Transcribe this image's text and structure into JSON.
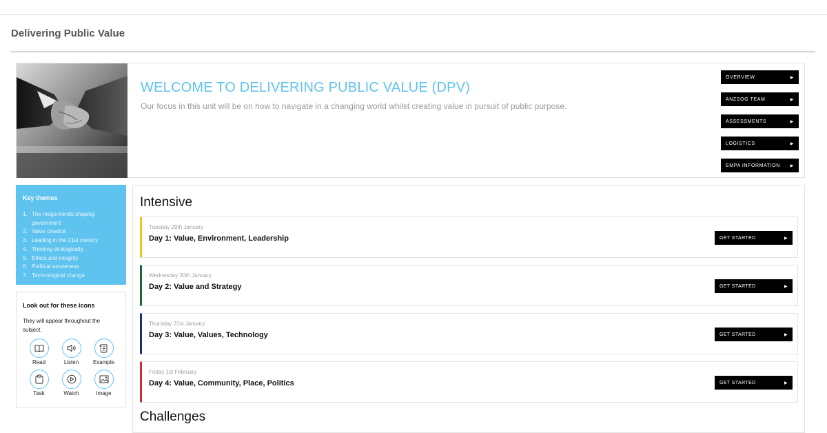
{
  "page": {
    "title": "Delivering Public Value"
  },
  "hero": {
    "title": "WELCOME TO DELIVERING PUBLIC VALUE (DPV)",
    "subtitle": "Our focus in this unit will be on how to navigate in a changing world whilst creating value in pursuit of public purpose.",
    "accent_color": "#5fc3ec",
    "nav": [
      {
        "label": "OVERVIEW",
        "icon": "play-arrow-icon"
      },
      {
        "label": "ANZSOG TEAM",
        "icon": "play-arrow-icon"
      },
      {
        "label": "ASSESSMENTS",
        "icon": "play-arrow-icon"
      },
      {
        "label": "LOGISTICS",
        "icon": "play-arrow-icon"
      },
      {
        "label": "EMPA INFORMATION",
        "icon": "play-arrow-icon"
      }
    ]
  },
  "themes": {
    "title": "Key themes",
    "background": "#5ec3ee",
    "items": [
      {
        "num": "1.",
        "text": "The mega-trends shaping government"
      },
      {
        "num": "2.",
        "text": "Value creation"
      },
      {
        "num": "3.",
        "text": "Leading in the 21st century"
      },
      {
        "num": "4.",
        "text": "Thinking strategically"
      },
      {
        "num": "5.",
        "text": "Ethics and integrity"
      },
      {
        "num": "6.",
        "text": "Political astuteness"
      },
      {
        "num": "7.",
        "text": "Technological change"
      }
    ]
  },
  "icons_box": {
    "title": "Look out for these icons",
    "description": "They will appear throughout the subject.",
    "icons": [
      {
        "label": "Read",
        "icon": "book-icon"
      },
      {
        "label": "Listen",
        "icon": "speaker-icon"
      },
      {
        "label": "Example",
        "icon": "scroll-icon"
      },
      {
        "label": "Task",
        "icon": "clipboard-icon"
      },
      {
        "label": "Watch",
        "icon": "play-circle-icon"
      },
      {
        "label": "Image",
        "icon": "image-icon"
      }
    ]
  },
  "intensive": {
    "heading": "Intensive",
    "days": [
      {
        "date": "Tuesday 29th January",
        "title": "Day 1: Value, Environment, Leadership",
        "button": "GET STARTED",
        "color": "#f0c419"
      },
      {
        "date": "Wednesday 30th January",
        "title": "Day 2: Value and Strategy",
        "button": "GET STARTED",
        "color": "#1a6b3c"
      },
      {
        "date": "Thursday 31st January",
        "title": "Day 3: Value, Values, Technology",
        "button": "GET STARTED",
        "color": "#16307a"
      },
      {
        "date": "Friday 1st February",
        "title": "Day 4: Value, Community, Place, Politics",
        "button": "GET STARTED",
        "color": "#d62e2e"
      }
    ]
  },
  "challenges": {
    "heading": "Challenges"
  }
}
